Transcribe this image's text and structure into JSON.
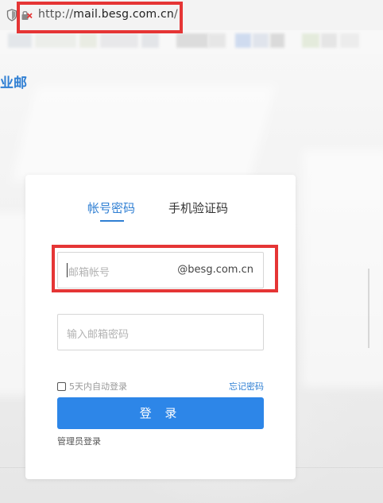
{
  "browser": {
    "url_scheme": "http://",
    "url_host": "mail.besg.com.cn",
    "url_path": "/",
    "lock_status": "not-secure-lock-icon",
    "shield": "shield-icon"
  },
  "page": {
    "brand_text": "业邮",
    "brand_color": "#2f7fd3",
    "tabs": [
      {
        "label": "帐号密码",
        "active": true
      },
      {
        "label": "手机验证码",
        "active": false
      }
    ],
    "account_field": {
      "placeholder": "邮箱帐号",
      "value": "",
      "domain_suffix": "@besg.com.cn"
    },
    "password_field": {
      "placeholder": "输入邮箱密码",
      "value": ""
    },
    "remember_label": "5天内自动登录",
    "remember_checked": false,
    "forgot_label": "忘记密码",
    "login_label": "登 录",
    "login_color": "#2d86e8",
    "admin_label": "管理员登录"
  },
  "annotation_color": "#e53535"
}
